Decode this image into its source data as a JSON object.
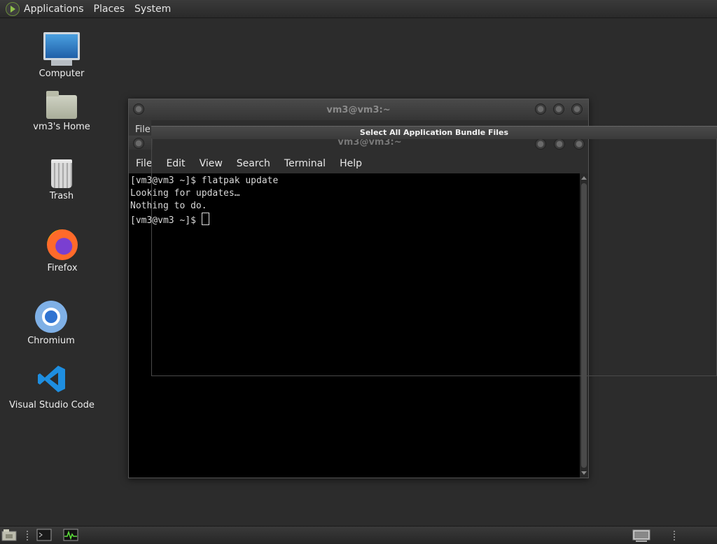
{
  "top_panel": {
    "menus": [
      "Applications",
      "Places",
      "System"
    ]
  },
  "desktop": {
    "icons": [
      {
        "label": "Computer",
        "icon": "computer-icon"
      },
      {
        "label": "vm3's Home",
        "icon": "home-folder-icon"
      },
      {
        "label": "Trash",
        "icon": "trash-icon"
      },
      {
        "label": "Firefox",
        "icon": "firefox-icon"
      },
      {
        "label": "Chromium",
        "icon": "chromium-icon"
      },
      {
        "label": "Visual Studio Code",
        "icon": "vscode-icon"
      }
    ]
  },
  "terminal_back": {
    "title": "vm3@vm3:~",
    "menu": [
      "File",
      "Edit",
      "View",
      "Search",
      "Terminal",
      "Help"
    ],
    "lines": [
      "[vm3@vm3 ~]$ flatpak update",
      "Looking for updates…",
      "",
      "Nothing to do.",
      "[vm3@vm3 ~]$ "
    ]
  },
  "terminal_front": {
    "title": "vm3@vm3:~",
    "partial_menu": "File"
  },
  "overlay": {
    "title": "Select All Application Bundle Files"
  },
  "colors": {
    "desktop_bg": "#2c2c2c",
    "terminal_bg": "#000000",
    "terminal_fg": "#d8d8d8"
  }
}
